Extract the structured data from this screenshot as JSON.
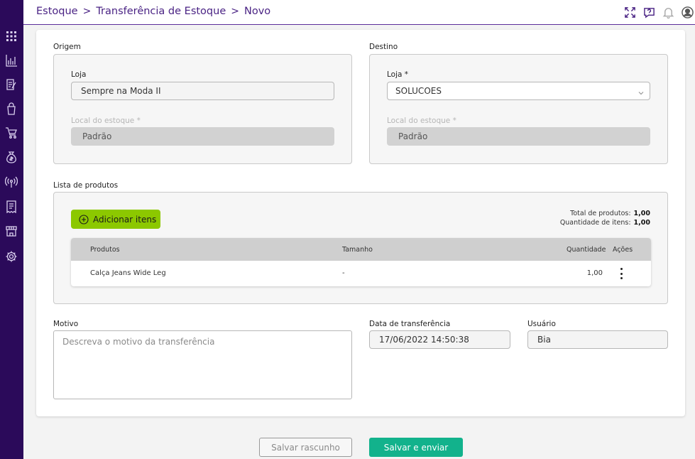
{
  "breadcrumb": {
    "items": [
      "Estoque",
      "Transferência de Estoque",
      "Novo"
    ],
    "separator": ">"
  },
  "header_icons": [
    "fullscreen-icon",
    "help-icon",
    "bell-icon",
    "user-avatar-icon"
  ],
  "sidebar_icons": [
    "apps-grid-icon",
    "chart-icon",
    "edit-document-icon",
    "shopping-bag-icon",
    "cart-icon",
    "money-bag-icon",
    "broadcast-icon",
    "receipt-icon",
    "store-icon",
    "settings-icon"
  ],
  "origem": {
    "title": "Origem",
    "loja_label": "Loja",
    "loja_value": "Sempre na Moda II",
    "local_label": "Local do estoque *",
    "local_value": "Padrão"
  },
  "destino": {
    "title": "Destino",
    "loja_label": "Loja *",
    "loja_value": "SOLUCOES",
    "local_label": "Local do estoque *",
    "local_value": "Padrão"
  },
  "produtos": {
    "title": "Lista de produtos",
    "add_label": "Adicionar itens",
    "total_label": "Total de produtos:",
    "total_value": "1,00",
    "qtd_label": "Quantidade de itens:",
    "qtd_value": "1,00",
    "columns": [
      "Produtos",
      "Tamanho",
      "Quantidade",
      "Ações"
    ],
    "rows": [
      {
        "produto": "Calça Jeans Wide Leg",
        "tamanho": "-",
        "quantidade": "1,00"
      }
    ]
  },
  "motivo": {
    "label": "Motivo",
    "placeholder": "Descreva o motivo da transferência"
  },
  "data_transferencia": {
    "label": "Data de transferência",
    "value": "17/06/2022 14:50:38"
  },
  "usuario": {
    "label": "Usuário",
    "value": "Bia"
  },
  "actions": {
    "draft_label": "Salvar rascunho",
    "send_label": "Salvar e enviar"
  },
  "colors": {
    "sidebar": "#2b0a5a",
    "accent": "#4a2384",
    "add_button": "#8cc800",
    "send_button": "#12b28c"
  }
}
